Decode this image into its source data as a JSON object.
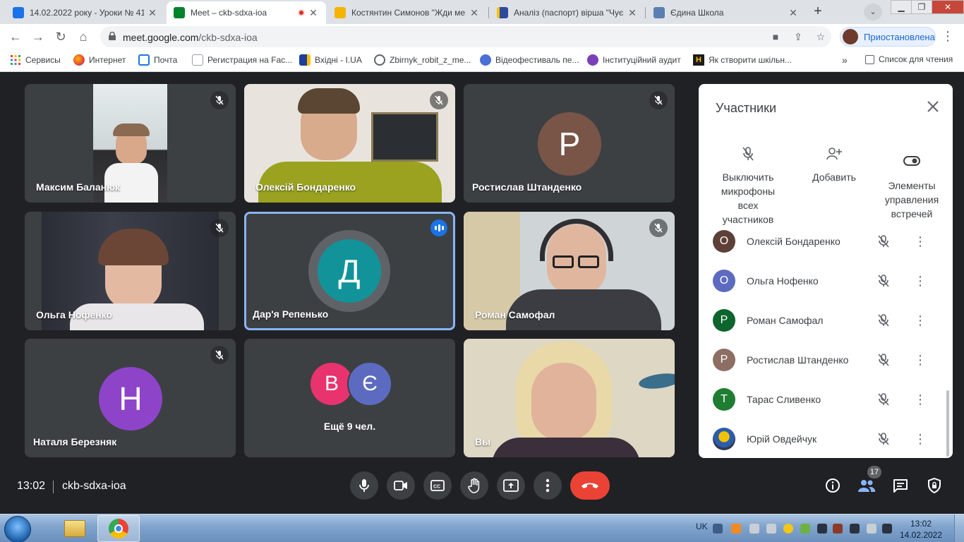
{
  "browser": {
    "tabs": [
      {
        "title": "14.02.2022 року - Уроки № 41",
        "favicon_color": "#1a73e8",
        "active": false
      },
      {
        "title": "Meet – ckb-sdxa-ioa",
        "favicon_color": "#00832d",
        "active": true
      },
      {
        "title": "Костянтин Симонов \"Жди ме",
        "favicon_color": "#f4b400",
        "active": false
      },
      {
        "title": "Аналіз (паспорт) вірша \"Чуєш",
        "favicon_color": "#2b4c9b",
        "active": false
      },
      {
        "title": "Єдина Школа",
        "favicon_color": "#5b7fb1",
        "active": false
      }
    ],
    "url_host": "meet.google.com",
    "url_path": "/ckb-sdxa-ioa",
    "profile_label": "Приостановлена",
    "bookmarks": [
      {
        "label": "Сервисы",
        "icon": "apps-grid-icon"
      },
      {
        "label": "Интернет",
        "icon": "globe-icon"
      },
      {
        "label": "Почта",
        "icon": "mail-icon"
      },
      {
        "label": "Регистрация на Fac...",
        "icon": "page-icon"
      },
      {
        "label": "Вхідні - I.UA",
        "icon": "iua-icon"
      },
      {
        "label": "Zbirnyk_robit_z_me...",
        "icon": "globe-icon"
      },
      {
        "label": "Відеофестиваль пе...",
        "icon": "globe-icon"
      },
      {
        "label": "Інституційний аудит",
        "icon": "globe-icon"
      },
      {
        "label": "Як створити шкільн...",
        "icon": "h-icon"
      }
    ],
    "bookmarks_more": "»",
    "reading_list": "Список для чтения"
  },
  "meet": {
    "tiles": [
      {
        "name": "Максим Баланюк",
        "type": "video",
        "muted": true
      },
      {
        "name": "Олексій Бондаренко",
        "type": "video",
        "muted": true
      },
      {
        "name": "Ростислав Штанденко",
        "type": "avatar",
        "initial": "Р",
        "color": "#795548",
        "muted": true
      },
      {
        "name": "Ольга Нофенко",
        "type": "video",
        "muted": true
      },
      {
        "name": "Дар'я Репенько",
        "type": "avatar",
        "initial": "Д",
        "color": "#12939a",
        "muted": false,
        "speaking": true
      },
      {
        "name": "Роман Самофал",
        "type": "video",
        "muted": true
      },
      {
        "name": "Наталя Березняк",
        "type": "avatar",
        "initial": "Н",
        "color": "#8e44c9",
        "muted": true
      },
      {
        "name": "Ещё 9 чел.",
        "type": "more",
        "initials": [
          "В",
          "Є"
        ],
        "colors": [
          "#e8336f",
          "#5c6bc0"
        ]
      },
      {
        "name": "Вы",
        "type": "video",
        "muted": false
      }
    ],
    "panel": {
      "title": "Участники",
      "actions": [
        {
          "label": "Выключить микрофоны всех участников",
          "icon": "mic-off-icon"
        },
        {
          "label": "Добавить",
          "icon": "add-person-icon"
        },
        {
          "label": "Элементы управления встречей",
          "icon": "toggle-icon"
        }
      ],
      "participants": [
        {
          "name": "Олексій Бондаренко",
          "initial": "О",
          "color": "#5d4037"
        },
        {
          "name": "Ольга Нофенко",
          "initial": "О",
          "color": "#5c6bc0"
        },
        {
          "name": "Роман Самофал",
          "initial": "Р",
          "color": "#0d652d"
        },
        {
          "name": "Ростислав Штанденко",
          "initial": "Р",
          "color": "#8d6e63"
        },
        {
          "name": "Тарас Сливенко",
          "initial": "Т",
          "color": "#1e7d32"
        },
        {
          "name": "Юрій Овдейчук",
          "initial": "",
          "color": "#2f3b52"
        }
      ]
    },
    "clock": "13:02",
    "meeting_code": "ckb-sdxa-ioa",
    "participant_count": "17",
    "accent_red": "#ea4335",
    "accent_blue": "#1a73e8"
  },
  "taskbar": {
    "language": "UK",
    "time": "13:02",
    "date": "14.02.2022"
  }
}
